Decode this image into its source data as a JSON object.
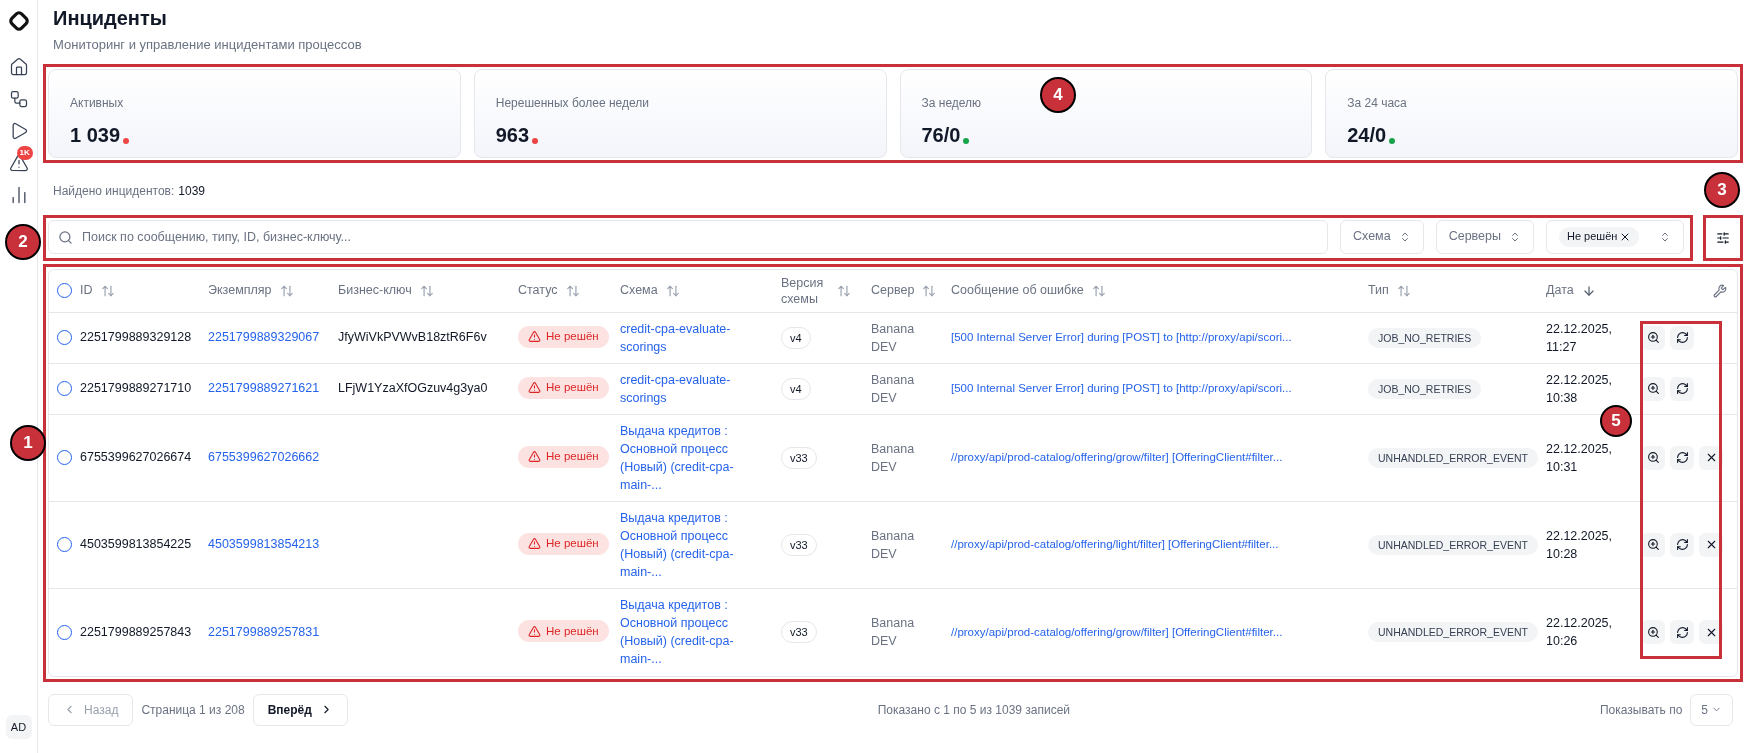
{
  "sidebar": {
    "alert_badge": "1K",
    "avatar": "AD"
  },
  "header": {
    "title": "Инциденты",
    "subtitle": "Мониторинг и управление инцидентами процессов"
  },
  "stats": [
    {
      "label": "Активных",
      "value": "1 039",
      "color": "#ef4444"
    },
    {
      "label": "Нерешенных более недели",
      "value": "963",
      "color": "#ef4444"
    },
    {
      "label": "За неделю",
      "value": "76/0",
      "color": "#16a34a"
    },
    {
      "label": "За 24 часа",
      "value": "24/0",
      "color": "#16a34a"
    }
  ],
  "found": {
    "label": "Найдено инцидентов:",
    "count": "1039"
  },
  "search": {
    "placeholder": "Поиск по сообщению, типу, ID, бизнес-ключу..."
  },
  "filters": [
    {
      "label": "Схема"
    },
    {
      "label": "Серверы"
    }
  ],
  "status_filter": {
    "chip": "Не решён"
  },
  "table": {
    "header_checked": false,
    "columns": [
      {
        "label": "ID",
        "sorted": false
      },
      {
        "label": "Экземпляр",
        "sorted": false
      },
      {
        "label": "Бизнес-ключ",
        "sorted": false
      },
      {
        "label": "Статус",
        "sorted": false
      },
      {
        "label": "Схема",
        "sorted": false
      },
      {
        "label": "Версия схемы",
        "sorted": false
      },
      {
        "label": "Сервер",
        "sorted": false
      },
      {
        "label": "Сообщение об ошибке",
        "sorted": false
      },
      {
        "label": "Тип",
        "sorted": false
      },
      {
        "label": "Дата",
        "sorted": true
      }
    ],
    "rows": [
      {
        "checked": false,
        "id": "2251799889329128",
        "instance": "2251799889329067",
        "business_key": "JfyWiVkPVWvB18ztR6F6v",
        "status": "Не решён",
        "schema": "credit-cpa-evaluate-scorings",
        "version": "v4",
        "server": "Banana DEV",
        "message": "[500 Internal Server Error] during [POST] to [http://proxy/api/scori...",
        "type": "JOB_NO_RETRIES",
        "date": "22.12.2025, 11:27",
        "cancellable": false
      },
      {
        "checked": false,
        "id": "2251799889271710",
        "instance": "2251799889271621",
        "business_key": "LFjW1YzaXfOGzuv4g3ya0",
        "status": "Не решён",
        "schema": "credit-cpa-evaluate-scorings",
        "version": "v4",
        "server": "Banana DEV",
        "message": "[500 Internal Server Error] during [POST] to [http://proxy/api/scori...",
        "type": "JOB_NO_RETRIES",
        "date": "22.12.2025, 10:38",
        "cancellable": false
      },
      {
        "checked": false,
        "id": "6755399627026674",
        "instance": "6755399627026662",
        "status": "Не решён",
        "schema": "Выдача кредитов : Основной процесс (Новый) (credit-cpa-main-...",
        "version": "v33",
        "server": "Banana DEV",
        "message": "//proxy/api/prod-catalog/offering/grow/filter] [OfferingClient#filter...",
        "type": "UNHANDLED_ERROR_EVENT",
        "date": "22.12.2025, 10:31",
        "cancellable": true
      },
      {
        "checked": false,
        "id": "4503599813854225",
        "instance": "4503599813854213",
        "status": "Не решён",
        "schema": "Выдача кредитов : Основной процесс (Новый) (credit-cpa-main-...",
        "version": "v33",
        "server": "Banana DEV",
        "message": "//proxy/api/prod-catalog/offering/light/filter] [OfferingClient#filter...",
        "type": "UNHANDLED_ERROR_EVENT",
        "date": "22.12.2025, 10:28",
        "cancellable": true
      },
      {
        "checked": false,
        "id": "2251799889257843",
        "instance": "2251799889257831",
        "status": "Не решён",
        "schema": "Выдача кредитов : Основной процесс (Новый) (credit-cpa-main-...",
        "version": "v33",
        "server": "Banana DEV",
        "message": "//proxy/api/prod-catalog/offering/grow/filter] [OfferingClient#filter...",
        "type": "UNHANDLED_ERROR_EVENT",
        "date": "22.12.2025, 10:26",
        "cancellable": true
      }
    ]
  },
  "pagination": {
    "prev": "Назад",
    "page": "Страница 1 из 208",
    "next": "Вперёд",
    "summary": "Показано с 1 по 5 из 1039 записей",
    "per_page_label": "Показывать по",
    "per_page": "5"
  },
  "annotations": [
    {
      "label": "1"
    },
    {
      "label": "2"
    },
    {
      "label": "3"
    },
    {
      "label": "4"
    },
    {
      "label": "5"
    }
  ]
}
